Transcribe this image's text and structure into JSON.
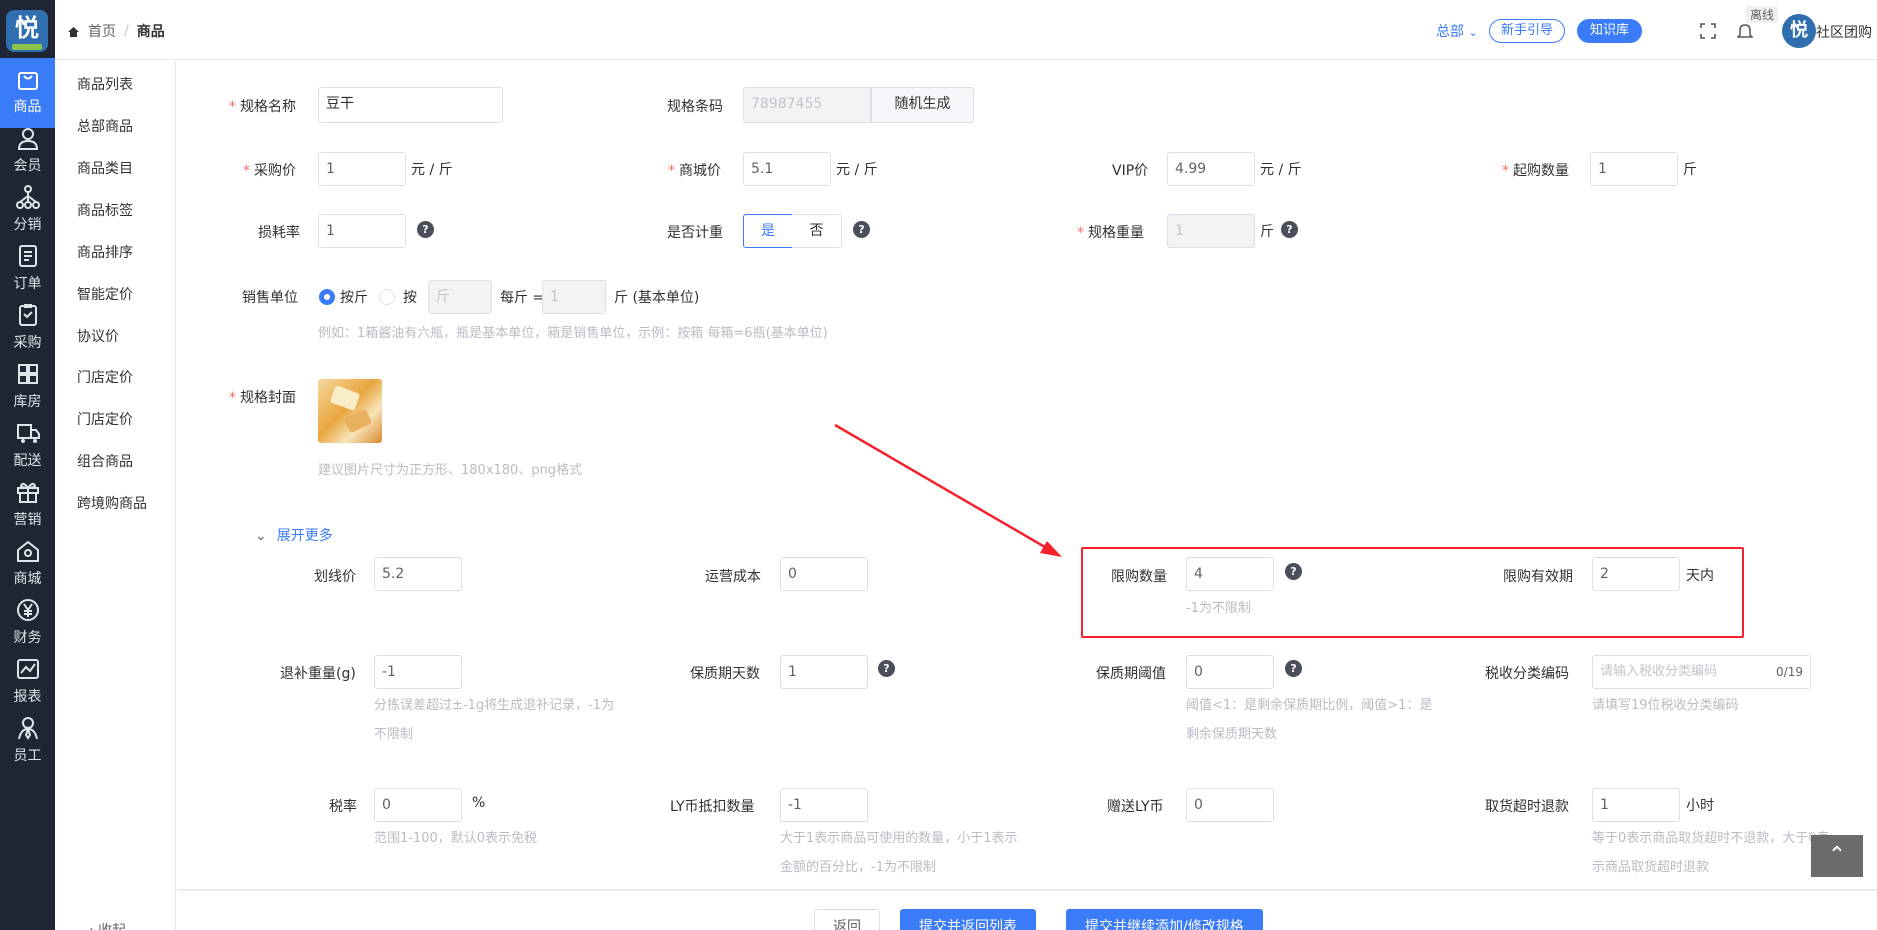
{
  "logo": {
    "text": "悦"
  },
  "sidebar": {
    "items": [
      {
        "label": "商品",
        "icon": "bag-icon",
        "active": true
      },
      {
        "label": "会员",
        "icon": "user-icon"
      },
      {
        "label": "分销",
        "icon": "network-icon"
      },
      {
        "label": "订单",
        "icon": "document-icon"
      },
      {
        "label": "采购",
        "icon": "clipboard-icon"
      },
      {
        "label": "库房",
        "icon": "warehouse-icon"
      },
      {
        "label": "配送",
        "icon": "truck-icon"
      },
      {
        "label": "营销",
        "icon": "gift-icon"
      },
      {
        "label": "商城",
        "icon": "home-icon"
      },
      {
        "label": "财务",
        "icon": "yen-icon"
      },
      {
        "label": "报表",
        "icon": "chart-icon"
      },
      {
        "label": "员工",
        "icon": "staff-icon"
      }
    ]
  },
  "submenu": {
    "items": [
      "商品列表",
      "总部商品",
      "商品类目",
      "商品标签",
      "商品排序",
      "智能定价",
      "协议价",
      "门店定价",
      "门店定价",
      "组合商品",
      "跨境购商品"
    ],
    "collapse": "收起"
  },
  "header": {
    "breadcrumb": {
      "home": "首页",
      "current": "商品"
    },
    "hq": "总部",
    "guide_btn": "新手引导",
    "kb_btn": "知识库",
    "offline": "离线",
    "user": "社区团购"
  },
  "form": {
    "spec_name": {
      "label": "规格名称",
      "value": "豆干"
    },
    "spec_barcode": {
      "label": "规格条码",
      "value": "78987455",
      "gen_btn": "随机生成"
    },
    "purchase_price": {
      "label": "采购价",
      "value": "1",
      "unit": "元 / 斤"
    },
    "mall_price": {
      "label": "商城价",
      "value": "5.1",
      "unit": "元 / 斤"
    },
    "vip_price": {
      "label": "VIP价",
      "value": "4.99",
      "unit": "元 / 斤"
    },
    "min_qty": {
      "label": "起购数量",
      "value": "1",
      "unit": "斤"
    },
    "loss_rate": {
      "label": "损耗率",
      "value": "1"
    },
    "weighing": {
      "label": "是否计重",
      "yes": "是",
      "no": "否"
    },
    "spec_weight": {
      "label": "规格重量",
      "value": "1",
      "unit": "斤"
    },
    "sale_unit": {
      "label": "销售单位",
      "opt1": "按斤",
      "opt2": "按",
      "unit_placeholder": "斤",
      "per": "每斤 =",
      "per_value": "1",
      "base": "斤 (基本单位)",
      "hint": "例如：1箱酱油有六瓶，瓶是基本单位，箱是销售单位，示例：按箱 每箱=6瓶(基本单位)"
    },
    "cover": {
      "label": "规格封面",
      "hint": "建议图片尺寸为正方形、180x180、png格式"
    },
    "expand": "展开更多",
    "strike_price": {
      "label": "划线价",
      "value": "5.2"
    },
    "op_cost": {
      "label": "运营成本",
      "value": "0"
    },
    "limit_qty": {
      "label": "限购数量",
      "value": "4",
      "hint": "-1为不限制"
    },
    "limit_period": {
      "label": "限购有效期",
      "value": "2",
      "unit": "天内"
    },
    "refund_weight": {
      "label": "退补重量(g)",
      "value": "-1",
      "hint1": "分拣误差超过±-1g将生成退补记录，-1为",
      "hint2": "不限制"
    },
    "shelf_days": {
      "label": "保质期天数",
      "value": "1"
    },
    "shelf_threshold": {
      "label": "保质期阈值",
      "value": "0",
      "hint1": "阈值<1：是剩余保质期比例，阈值>1：是",
      "hint2": "剩余保质期天数"
    },
    "tax_code": {
      "label": "税收分类编码",
      "placeholder": "请输入税收分类编码",
      "count": "0/19",
      "hint": "请填写19位税收分类编码"
    },
    "tax_rate": {
      "label": "税率",
      "value": "0",
      "unit": "%",
      "hint": "范围1-100，默认0表示免税"
    },
    "ly_deduct": {
      "label": "LY币抵扣数量",
      "value": "-1",
      "hint1": "大于1表示商品可使用的数量，小于1表示",
      "hint2": "金额的百分比，-1为不限制"
    },
    "gift_ly": {
      "label": "赠送LY币",
      "value": "0"
    },
    "pickup_refund": {
      "label": "取货超时退款",
      "value": "1",
      "unit": "小时",
      "hint1": "等于0表示商品取货超时不退款，大于0表",
      "hint2": "示商品取货超时退款"
    }
  },
  "footer": {
    "back": "返回",
    "submit_back": "提交并返回列表",
    "submit_continue": "提交并继续添加/修改规格"
  },
  "colors": {
    "primary": "#3a7bf7",
    "nav_bg": "#1f2533",
    "highlight": "#f5222d"
  }
}
